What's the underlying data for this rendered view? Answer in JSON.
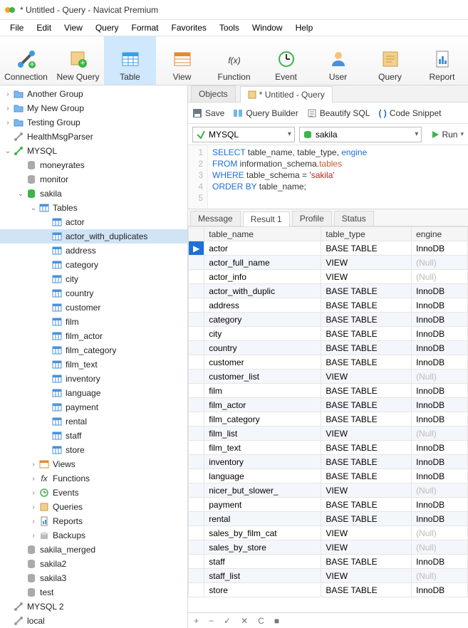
{
  "window": {
    "title": "* Untitled - Query - Navicat Premium"
  },
  "menu": [
    "File",
    "Edit",
    "View",
    "Query",
    "Format",
    "Favorites",
    "Tools",
    "Window",
    "Help"
  ],
  "toolbar": [
    {
      "label": "Connection"
    },
    {
      "label": "New Query"
    },
    {
      "label": "Table"
    },
    {
      "label": "View"
    },
    {
      "label": "Function"
    },
    {
      "label": "Event"
    },
    {
      "label": "User"
    },
    {
      "label": "Query"
    },
    {
      "label": "Report"
    }
  ],
  "tabs": {
    "objects": "Objects",
    "query": "* Untitled - Query"
  },
  "actions": {
    "save": "Save",
    "query_builder": "Query Builder",
    "beautify": "Beautify SQL",
    "snippet": "Code Snippet"
  },
  "conn": {
    "connection": "MYSQL",
    "schema": "sakila",
    "run": "Run"
  },
  "sql": {
    "l1": {
      "select": "SELECT",
      "cols": " table_name, table_type, ",
      "engine": "engine"
    },
    "l2": {
      "from": "FROM",
      "schema": " information_schema.",
      "tables": "tables"
    },
    "l3": {
      "where": "WHERE",
      "cond": " table_schema = ",
      "val": "'sakila'"
    },
    "l4": {
      "order": "ORDER BY",
      "col": " table_name;"
    }
  },
  "restabs": [
    "Message",
    "Result 1",
    "Profile",
    "Status"
  ],
  "grid": {
    "headers": [
      "table_name",
      "table_type",
      "engine"
    ],
    "rows": [
      {
        "n": "actor",
        "t": "BASE TABLE",
        "e": "InnoDB",
        "sel": true
      },
      {
        "n": "actor_full_name",
        "t": "VIEW",
        "e": null
      },
      {
        "n": "actor_info",
        "t": "VIEW",
        "e": null
      },
      {
        "n": "actor_with_duplic",
        "t": "BASE TABLE",
        "e": "InnoDB"
      },
      {
        "n": "address",
        "t": "BASE TABLE",
        "e": "InnoDB"
      },
      {
        "n": "category",
        "t": "BASE TABLE",
        "e": "InnoDB"
      },
      {
        "n": "city",
        "t": "BASE TABLE",
        "e": "InnoDB"
      },
      {
        "n": "country",
        "t": "BASE TABLE",
        "e": "InnoDB"
      },
      {
        "n": "customer",
        "t": "BASE TABLE",
        "e": "InnoDB"
      },
      {
        "n": "customer_list",
        "t": "VIEW",
        "e": null
      },
      {
        "n": "film",
        "t": "BASE TABLE",
        "e": "InnoDB"
      },
      {
        "n": "film_actor",
        "t": "BASE TABLE",
        "e": "InnoDB"
      },
      {
        "n": "film_category",
        "t": "BASE TABLE",
        "e": "InnoDB"
      },
      {
        "n": "film_list",
        "t": "VIEW",
        "e": null
      },
      {
        "n": "film_text",
        "t": "BASE TABLE",
        "e": "InnoDB"
      },
      {
        "n": "inventory",
        "t": "BASE TABLE",
        "e": "InnoDB"
      },
      {
        "n": "language",
        "t": "BASE TABLE",
        "e": "InnoDB"
      },
      {
        "n": "nicer_but_slower_",
        "t": "VIEW",
        "e": null
      },
      {
        "n": "payment",
        "t": "BASE TABLE",
        "e": "InnoDB"
      },
      {
        "n": "rental",
        "t": "BASE TABLE",
        "e": "InnoDB"
      },
      {
        "n": "sales_by_film_cat",
        "t": "VIEW",
        "e": null
      },
      {
        "n": "sales_by_store",
        "t": "VIEW",
        "e": null
      },
      {
        "n": "staff",
        "t": "BASE TABLE",
        "e": "InnoDB"
      },
      {
        "n": "staff_list",
        "t": "VIEW",
        "e": null
      },
      {
        "n": "store",
        "t": "BASE TABLE",
        "e": "InnoDB"
      }
    ]
  },
  "tree": [
    {
      "d": 0,
      "tw": ">",
      "icon": "folder",
      "label": "Another Group"
    },
    {
      "d": 0,
      "tw": ">",
      "icon": "folder",
      "label": "My New Group"
    },
    {
      "d": 0,
      "tw": ">",
      "icon": "folder",
      "label": "Testing Group"
    },
    {
      "d": 0,
      "tw": "",
      "icon": "conn-g",
      "label": "HealthMsgParser"
    },
    {
      "d": 0,
      "tw": "v",
      "icon": "conn",
      "label": "MYSQL"
    },
    {
      "d": 1,
      "tw": "",
      "icon": "db-g",
      "label": "moneyrates"
    },
    {
      "d": 1,
      "tw": "",
      "icon": "db-g",
      "label": "monitor"
    },
    {
      "d": 1,
      "tw": "v",
      "icon": "db",
      "label": "sakila"
    },
    {
      "d": 2,
      "tw": "v",
      "icon": "tables",
      "label": "Tables"
    },
    {
      "d": 3,
      "tw": "",
      "icon": "table",
      "label": "actor"
    },
    {
      "d": 3,
      "tw": "",
      "icon": "table",
      "label": "actor_with_duplicates",
      "sel": true
    },
    {
      "d": 3,
      "tw": "",
      "icon": "table",
      "label": "address"
    },
    {
      "d": 3,
      "tw": "",
      "icon": "table",
      "label": "category"
    },
    {
      "d": 3,
      "tw": "",
      "icon": "table",
      "label": "city"
    },
    {
      "d": 3,
      "tw": "",
      "icon": "table",
      "label": "country"
    },
    {
      "d": 3,
      "tw": "",
      "icon": "table",
      "label": "customer"
    },
    {
      "d": 3,
      "tw": "",
      "icon": "table",
      "label": "film"
    },
    {
      "d": 3,
      "tw": "",
      "icon": "table",
      "label": "film_actor"
    },
    {
      "d": 3,
      "tw": "",
      "icon": "table",
      "label": "film_category"
    },
    {
      "d": 3,
      "tw": "",
      "icon": "table",
      "label": "film_text"
    },
    {
      "d": 3,
      "tw": "",
      "icon": "table",
      "label": "inventory"
    },
    {
      "d": 3,
      "tw": "",
      "icon": "table",
      "label": "language"
    },
    {
      "d": 3,
      "tw": "",
      "icon": "table",
      "label": "payment"
    },
    {
      "d": 3,
      "tw": "",
      "icon": "table",
      "label": "rental"
    },
    {
      "d": 3,
      "tw": "",
      "icon": "table",
      "label": "staff"
    },
    {
      "d": 3,
      "tw": "",
      "icon": "table",
      "label": "store"
    },
    {
      "d": 2,
      "tw": ">",
      "icon": "views",
      "label": "Views"
    },
    {
      "d": 2,
      "tw": ">",
      "icon": "fx",
      "label": "Functions"
    },
    {
      "d": 2,
      "tw": ">",
      "icon": "event",
      "label": "Events"
    },
    {
      "d": 2,
      "tw": ">",
      "icon": "query",
      "label": "Queries"
    },
    {
      "d": 2,
      "tw": ">",
      "icon": "report",
      "label": "Reports"
    },
    {
      "d": 2,
      "tw": ">",
      "icon": "backup",
      "label": "Backups"
    },
    {
      "d": 1,
      "tw": "",
      "icon": "db-g",
      "label": "sakila_merged"
    },
    {
      "d": 1,
      "tw": "",
      "icon": "db-g",
      "label": "sakila2"
    },
    {
      "d": 1,
      "tw": "",
      "icon": "db-g",
      "label": "sakila3"
    },
    {
      "d": 1,
      "tw": "",
      "icon": "db-g",
      "label": "test"
    },
    {
      "d": 0,
      "tw": "",
      "icon": "conn-g",
      "label": "MYSQL 2"
    },
    {
      "d": 0,
      "tw": "",
      "icon": "conn-g",
      "label": "local"
    }
  ],
  "null_text": "(Null)"
}
